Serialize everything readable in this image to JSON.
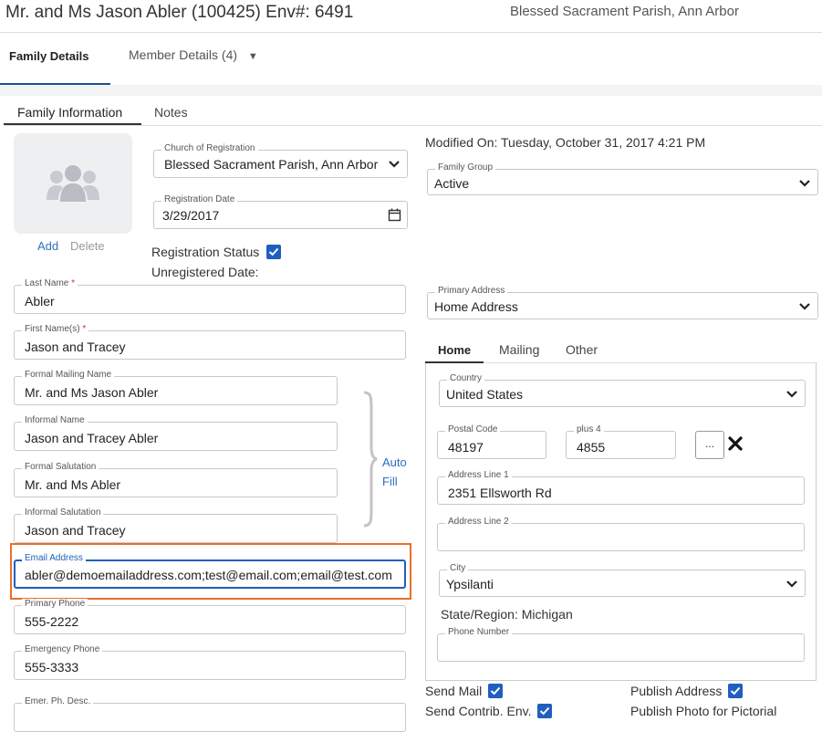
{
  "header": {
    "title": "Mr. and Ms Jason Abler (100425) Env#: 6491",
    "parish": "Blessed Sacrament Parish, Ann Arbor"
  },
  "main_tabs": {
    "family": "Family Details",
    "member": "Member Details (4)",
    "member_caret": "▼"
  },
  "sub_tabs": {
    "family_info": "Family Information",
    "notes": "Notes"
  },
  "photo": {
    "icon": "users-icon",
    "add": "Add",
    "delete": "Delete"
  },
  "church": {
    "label": "Church of Registration",
    "value": "Blessed Sacrament Parish, Ann Arbor"
  },
  "registration_date": {
    "label": "Registration Date",
    "value": "3/29/2017",
    "icon": "calendar-icon"
  },
  "registration_status": {
    "label": "Registration Status",
    "checked": true
  },
  "unregistered_date": {
    "label": "Unregistered Date:"
  },
  "modified_on": "Modified On: Tuesday, October 31, 2017 4:21 PM",
  "family_group": {
    "label": "Family Group",
    "value": "Active"
  },
  "last_name": {
    "label": "Last Name",
    "required": "*",
    "value": "Abler"
  },
  "first_names": {
    "label": "First Name(s)",
    "required": "*",
    "value": "Jason and Tracey"
  },
  "formal_mailing": {
    "label": "Formal Mailing Name",
    "value": "Mr. and Ms Jason Abler"
  },
  "informal_name": {
    "label": "Informal Name",
    "value": "Jason and Tracey Abler"
  },
  "formal_salutation": {
    "label": "Formal Salutation",
    "value": "Mr. and Ms Abler"
  },
  "informal_salutation": {
    "label": "Informal Salutation",
    "value": "Jason and Tracey"
  },
  "auto_fill": {
    "line1": "Auto",
    "line2": "Fill"
  },
  "email": {
    "label": "Email Address",
    "value": "abler@demoemailaddress.com;test@email.com;email@test.com"
  },
  "primary_phone": {
    "label": "Primary Phone",
    "value": "555-2222"
  },
  "emergency_phone": {
    "label": "Emergency Phone",
    "value": "555-3333"
  },
  "emer_desc": {
    "label": "Emer. Ph. Desc.",
    "value": ""
  },
  "primary_address": {
    "label": "Primary Address",
    "value": "Home Address"
  },
  "address_tabs": {
    "home": "Home",
    "mailing": "Mailing",
    "other": "Other"
  },
  "address": {
    "country": {
      "label": "Country",
      "value": "United States"
    },
    "postal_code": {
      "label": "Postal Code",
      "value": "48197"
    },
    "plus4": {
      "label": "plus 4",
      "value": "4855"
    },
    "lookup_button": "...",
    "line1": {
      "label": "Address Line 1",
      "value": "2351 Ellsworth Rd"
    },
    "line2": {
      "label": "Address Line 2",
      "value": ""
    },
    "city": {
      "label": "City",
      "value": "Ypsilanti"
    },
    "state": "State/Region: Michigan",
    "phone": {
      "label": "Phone Number",
      "value": ""
    }
  },
  "flags": {
    "send_mail": "Send Mail",
    "publish_address": "Publish Address",
    "send_contrib": "Send Contrib. Env.",
    "publish_photo": "Publish Photo for Pictorial"
  },
  "colors": {
    "accent": "#1f5fbf",
    "highlight": "#e8702a",
    "link": "#2f6fbf"
  }
}
